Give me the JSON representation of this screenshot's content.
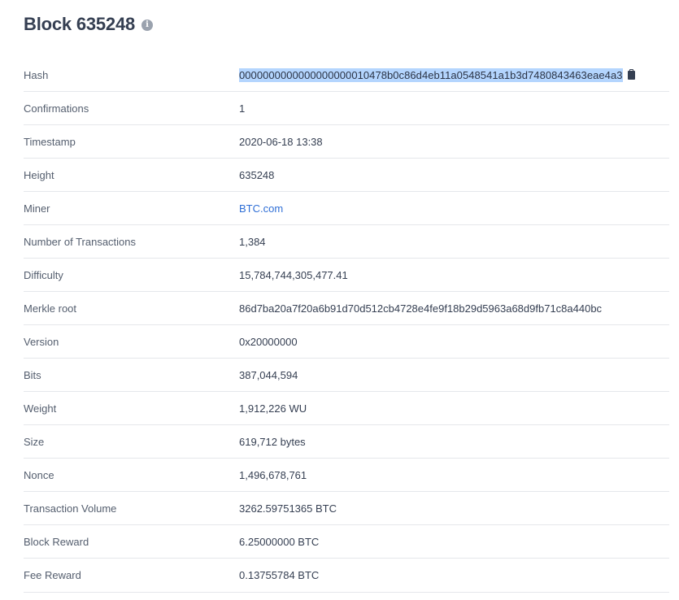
{
  "title": "Block 635248",
  "info_icon": "info-icon",
  "copy_icon": "clipboard-icon",
  "colors": {
    "title": "#353f52",
    "link": "#2f6fd6",
    "selection": "#b4d5fe",
    "divider": "#e5e7eb"
  },
  "rows": [
    {
      "label": "Hash",
      "value": "0000000000000000000010478b0c86d4eb11a0548541a1b3d7480843463eae4a3"
    },
    {
      "label": "Confirmations",
      "value": "1"
    },
    {
      "label": "Timestamp",
      "value": "2020-06-18 13:38"
    },
    {
      "label": "Height",
      "value": "635248"
    },
    {
      "label": "Miner",
      "value": "BTC.com"
    },
    {
      "label": "Number of Transactions",
      "value": "1,384"
    },
    {
      "label": "Difficulty",
      "value": "15,784,744,305,477.41"
    },
    {
      "label": "Merkle root",
      "value": "86d7ba20a7f20a6b91d70d512cb4728e4fe9f18b29d5963a68d9fb71c8a440bc"
    },
    {
      "label": "Version",
      "value": "0x20000000"
    },
    {
      "label": "Bits",
      "value": "387,044,594"
    },
    {
      "label": "Weight",
      "value": "1,912,226 WU"
    },
    {
      "label": "Size",
      "value": "619,712 bytes"
    },
    {
      "label": "Nonce",
      "value": "1,496,678,761"
    },
    {
      "label": "Transaction Volume",
      "value": "3262.59751365 BTC"
    },
    {
      "label": "Block Reward",
      "value": "6.25000000 BTC"
    },
    {
      "label": "Fee Reward",
      "value": "0.13755784 BTC"
    }
  ]
}
